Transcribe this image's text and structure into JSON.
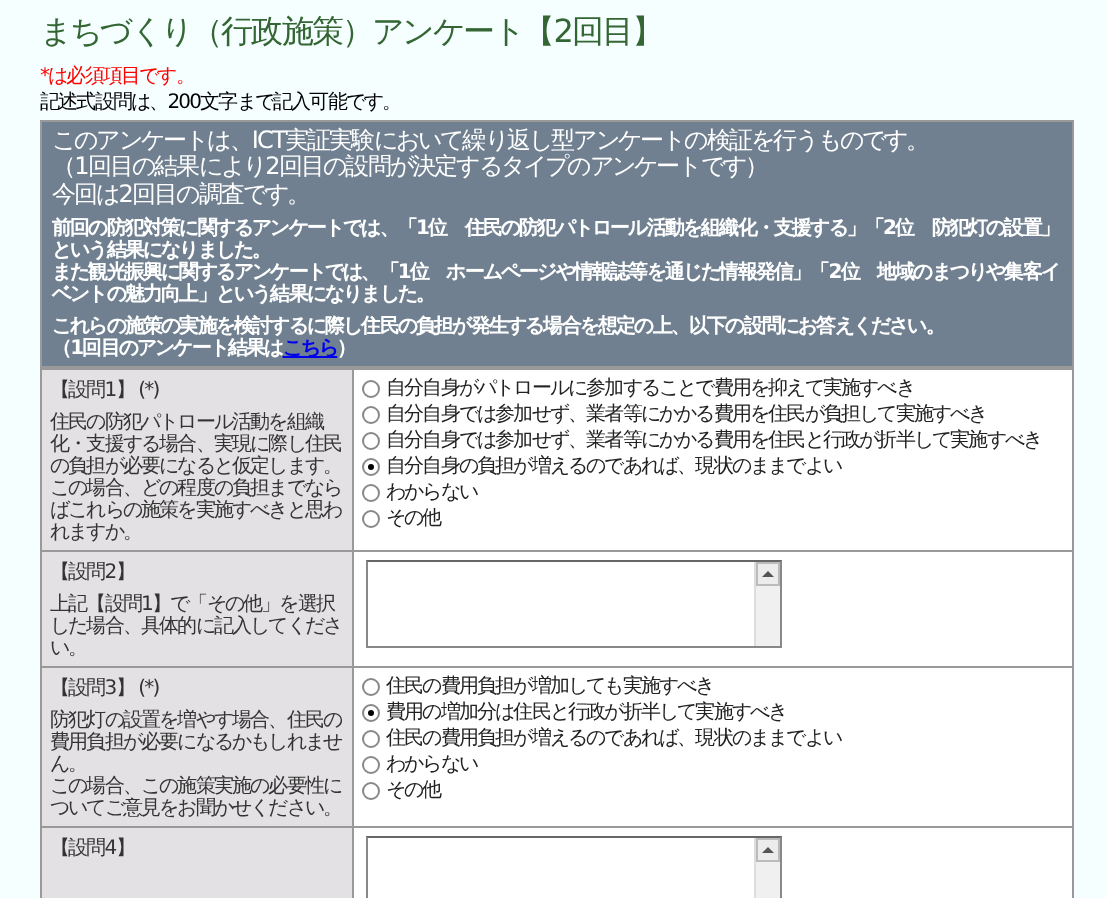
{
  "title": "まちづくり（行政施策）アンケート【2回目】",
  "required_note": "*は必須項目です。",
  "note": "記述式設問は、200文字まで記入可能です。",
  "intro": {
    "lead_lines": [
      "このアンケートは、ICT実証実験において繰り返し型アンケートの検証を行うものです。",
      "（1回目の結果により2回目の設問が決定するタイプのアンケートです）",
      "今回は2回目の調査です。"
    ],
    "paragraphs": [
      [
        "前回の防犯対策に関するアンケートでは、「1位　住民の防犯パトロール活動を組織化・支援する」「2位　防犯灯の設置」という結果になりました。",
        "また観光振興に関するアンケートでは、「1位　ホームページや情報誌等を通じた情報発信」「2位　地域のまつりや集客イベントの魅力向上」という結果になりました。"
      ],
      [
        "これらの施策の実施を検討するに際し住民の負担が発生する場合を想定の上、以下の設問にお答えください。"
      ]
    ],
    "link_prefix": "（1回目のアンケート結果は",
    "link": "こちら",
    "link_suffix": "）"
  },
  "questions": [
    {
      "kind": "radio",
      "label": "【設問1】",
      "required_mark": "(*)",
      "description": [
        "住民の防犯パトロール活動を組織化・支援する場合、実現に際し住民の負担が必要になると仮定します。",
        "この場合、どの程度の負担までならばこれらの施策を実施すべきと思われますか。"
      ],
      "options": [
        {
          "label": "自分自身がパトロールに参加することで費用を抑えて実施すべき",
          "selected": false
        },
        {
          "label": "自分自身では参加せず、業者等にかかる費用を住民が負担して実施すべき",
          "selected": false
        },
        {
          "label": "自分自身では参加せず、業者等にかかる費用を住民と行政が折半して実施すべき",
          "selected": false
        },
        {
          "label": "自分自身の負担が増えるのであれば、現状のままでよい",
          "selected": true
        },
        {
          "label": "わからない",
          "selected": false
        },
        {
          "label": "その他",
          "selected": false
        }
      ]
    },
    {
      "kind": "text",
      "label": "【設問2】",
      "description": [
        "上記【設問1】で「その他」を選択した場合、具体的に記入してください。"
      ]
    },
    {
      "kind": "radio",
      "label": "【設問3】",
      "required_mark": "(*)",
      "description": [
        "防犯灯の設置を増やす場合、住民の費用負担が必要になるかもしれません。",
        "この場合、この施策実施の必要性についてご意見をお聞かせください。"
      ],
      "options": [
        {
          "label": "住民の費用負担が増加しても実施すべき",
          "selected": false
        },
        {
          "label": "費用の増加分は住民と行政が折半して実施すべき",
          "selected": true
        },
        {
          "label": "住民の費用負担が増えるのであれば、現状のままでよい",
          "selected": false
        },
        {
          "label": "わからない",
          "selected": false
        },
        {
          "label": "その他",
          "selected": false
        }
      ]
    },
    {
      "kind": "text",
      "label": "【設問4】"
    }
  ]
}
